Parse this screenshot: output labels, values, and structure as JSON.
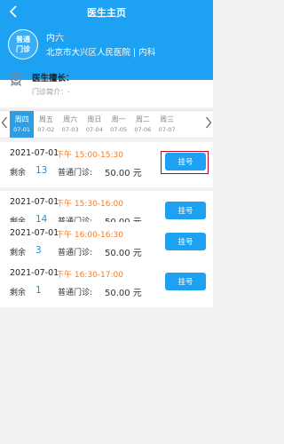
{
  "header": {
    "title": "医生主页",
    "avatar_text": "普通\n门诊",
    "doctor_name": "内六",
    "hospital_dept": "北京市大兴区人民医院 | 内科"
  },
  "info": {
    "specialty_label": "医生擅长：",
    "intro_label": "门诊简介：-"
  },
  "dates": [
    {
      "weekday": "周四",
      "date": "07-01"
    },
    {
      "weekday": "周五",
      "date": "07-02"
    },
    {
      "weekday": "周六",
      "date": "07-03"
    },
    {
      "weekday": "周日",
      "date": "07-04"
    },
    {
      "weekday": "周一",
      "date": "07-05"
    },
    {
      "weekday": "周二",
      "date": "07-06"
    },
    {
      "weekday": "周三",
      "date": "07-07"
    }
  ],
  "slots": [
    {
      "date": "2021-07-01",
      "time": "下午  15:00-15:30",
      "remain_label": "剩余",
      "remain": "13",
      "type": "普通门诊:",
      "price": "50.00 元",
      "button": "挂号"
    },
    {
      "date": "2021-07-01",
      "time": "下午  15:30-16:00",
      "remain_label": "剩余",
      "remain": "14",
      "type": "普通门诊:",
      "price": "50.00 元",
      "button": "挂号"
    },
    {
      "date": "2021-07-01",
      "time": "下午  16:00-16:30",
      "remain_label": "剩余",
      "remain": "3",
      "type": "普通门诊:",
      "price": "50.00 元",
      "button": "挂号"
    },
    {
      "date": "2021-07-01",
      "time": "下午  16:30-17:00",
      "remain_label": "剩余",
      "remain": "1",
      "type": "普通门诊:",
      "price": "50.00 元",
      "button": "挂号"
    }
  ],
  "colors": {
    "brand": "#1da1f2",
    "time": "#ff7a1a",
    "highlight": "#d0021b"
  }
}
